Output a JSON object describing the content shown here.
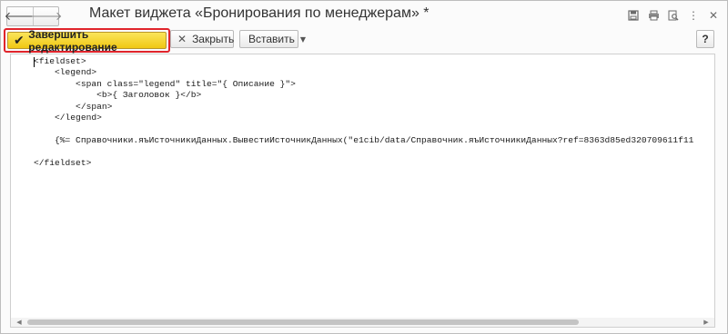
{
  "window": {
    "title": "Макет виджета «Бронирования по менеджерам» *"
  },
  "nav": {
    "back_icon": "arrow-left-icon",
    "forward_icon": "arrow-right-icon"
  },
  "title_icons": [
    "save-icon",
    "print-icon",
    "preview-icon",
    "more-icon",
    "close-icon"
  ],
  "toolbar": {
    "finish_label": "Завершить редактирование",
    "close_label": "Закрыть",
    "insert_label": "Вставить",
    "help_label": "?"
  },
  "editor": {
    "code": "<fieldset>\n    <legend>\n        <span class=\"legend\" title=\"{ Описание }\">\n            <b>{ Заголовок }</b>\n        </span>\n    </legend>\n\n    {%= Справочники.яъИсточникиДанных.ВывестиИсточникДанных(\"e1cib/data/Справочник.яъИсточникиДанных?ref=8363d85ed320709611f11\n\n</fieldset>"
  },
  "colors": {
    "highlight_border": "#e0242b",
    "primary_button": "#f6d632"
  }
}
